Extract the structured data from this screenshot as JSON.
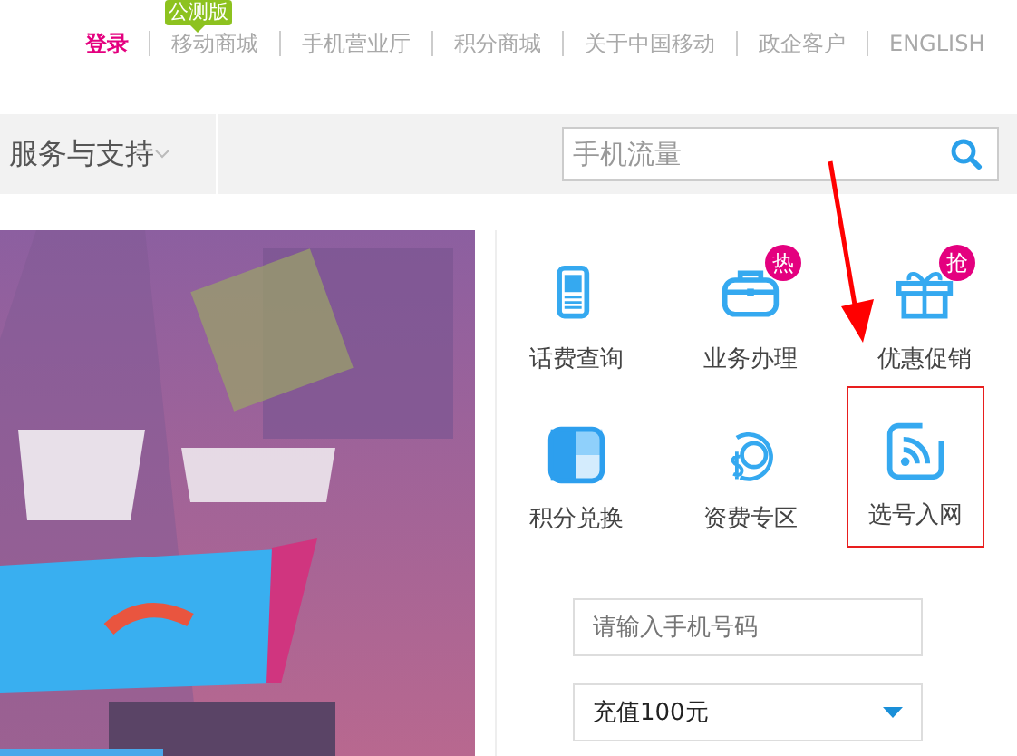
{
  "top_nav": {
    "login": "登录",
    "links": [
      {
        "label": "移动商城",
        "badge": "公测版"
      },
      {
        "label": "手机营业厅"
      },
      {
        "label": "积分商城"
      },
      {
        "label": "关于中国移动"
      },
      {
        "label": "政企客户"
      },
      {
        "label": "ENGLISH"
      }
    ]
  },
  "header": {
    "menu": "服务与支持",
    "search": {
      "placeholder": "手机流量"
    }
  },
  "services": [
    {
      "label": "话费查询",
      "kind": "bill",
      "highlighted": false
    },
    {
      "label": "业务办理",
      "kind": "briefcase",
      "badge": "热",
      "highlighted": false
    },
    {
      "label": "优惠促销",
      "kind": "gift",
      "badge": "抢",
      "highlighted": false
    },
    {
      "label": "积分兑换",
      "kind": "points",
      "highlighted": false
    },
    {
      "label": "资费专区",
      "kind": "fee",
      "highlighted": false
    },
    {
      "label": "选号入网",
      "kind": "rss",
      "highlighted": true
    }
  ],
  "recharge": {
    "phone": {
      "placeholder": "请输入手机号码"
    },
    "amount": {
      "value": "充值100元"
    }
  }
}
